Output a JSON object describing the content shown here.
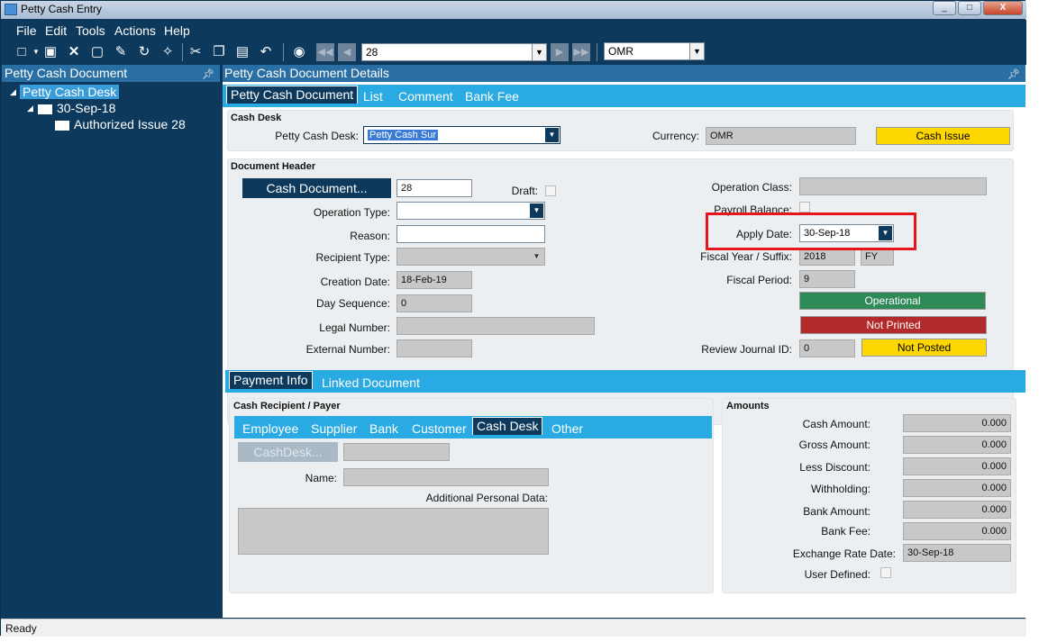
{
  "window": {
    "title": "Petty Cash Entry",
    "min": "_",
    "max": "□",
    "close": "X"
  },
  "menu": [
    "File",
    "Edit",
    "Tools",
    "Actions",
    "Help"
  ],
  "toolbar": {
    "icons": [
      "new-icon",
      "save-icon",
      "delete-icon",
      "clear-icon",
      "edit-icon",
      "refresh-icon",
      "clean-icon",
      "cut-icon",
      "copy-icon",
      "paste-icon",
      "undo-icon",
      "find-icon"
    ],
    "record_value": "28",
    "currency_value": "OMR"
  },
  "left_panel": {
    "title": "Petty Cash Document",
    "tree": [
      {
        "label": "Petty Cash Desk",
        "level": 0,
        "selected": true
      },
      {
        "label": "30-Sep-18",
        "level": 1
      },
      {
        "label": "Authorized Issue 28",
        "level": 2
      }
    ]
  },
  "right_panel": {
    "title": "Petty Cash Document Details",
    "tabs": [
      "Petty Cash Document",
      "List",
      "Comment",
      "Bank Fee"
    ],
    "cash_desk": {
      "section_title": "Cash Desk",
      "petty_cash_desk_label": "Petty Cash Desk:",
      "petty_cash_desk_value": "Petty Cash Sur",
      "currency_label": "Currency:",
      "currency_value": "OMR",
      "cash_issue": "Cash Issue"
    },
    "doc_header": {
      "section_title": "Document Header",
      "cash_document_button": "Cash Document...",
      "cash_document_value": "28",
      "draft_label": "Draft:",
      "operation_type_label": "Operation Type:",
      "reason_label": "Reason:",
      "recipient_type_label": "Recipient Type:",
      "creation_date_label": "Creation Date:",
      "creation_date_value": "18-Feb-19",
      "day_sequence_label": "Day Sequence:",
      "day_sequence_value": "0",
      "legal_number_label": "Legal Number:",
      "external_number_label": "External Number:",
      "operation_class_label": "Operation Class:",
      "payroll_balance_label": "Payroll Balance:",
      "apply_date_label": "Apply Date:",
      "apply_date_value": "30-Sep-18",
      "fiscal_year_label": "Fiscal Year / Suffix:",
      "fiscal_year_value": "2018",
      "fiscal_suffix_value": "FY",
      "fiscal_period_label": "Fiscal Period:",
      "fiscal_period_value": "9",
      "status_operational": "Operational",
      "status_printed": "Not Printed",
      "review_journal_label": "Review Journal ID:",
      "review_journal_value": "0",
      "status_posted": "Not Posted"
    },
    "lower_tabs": [
      "Payment Info",
      "Linked Document"
    ],
    "recipient": {
      "section_title": "Cash Recipient / Payer",
      "tabs": [
        "Employee",
        "Supplier",
        "Bank",
        "Customer",
        "Cash Desk",
        "Other"
      ],
      "cashdesk_button": "CashDesk...",
      "name_label": "Name:",
      "additional_label": "Additional Personal Data:"
    },
    "amounts": {
      "section_title": "Amounts",
      "rows": [
        {
          "label": "Cash Amount:",
          "value": "0.000"
        },
        {
          "label": "Gross Amount:",
          "value": "0.000"
        },
        {
          "label": "Less Discount:",
          "value": "0.000"
        },
        {
          "label": "Withholding:",
          "value": "0.000"
        },
        {
          "label": "Bank Amount:",
          "value": "0.000"
        },
        {
          "label": "Bank Fee:",
          "value": "0.000"
        }
      ],
      "exchange_rate_date_label": "Exchange Rate Date:",
      "exchange_rate_date_value": "30-Sep-18",
      "user_defined_label": "User Defined:"
    }
  },
  "statusbar": {
    "text": "Ready"
  },
  "colors": {
    "frame": "#0d3a5c",
    "tab_bar": "#2aaae2",
    "highlight": "#e8141c",
    "operational": "#2e8b57",
    "not_printed": "#b22a2a",
    "yellow": "#ffd700"
  }
}
